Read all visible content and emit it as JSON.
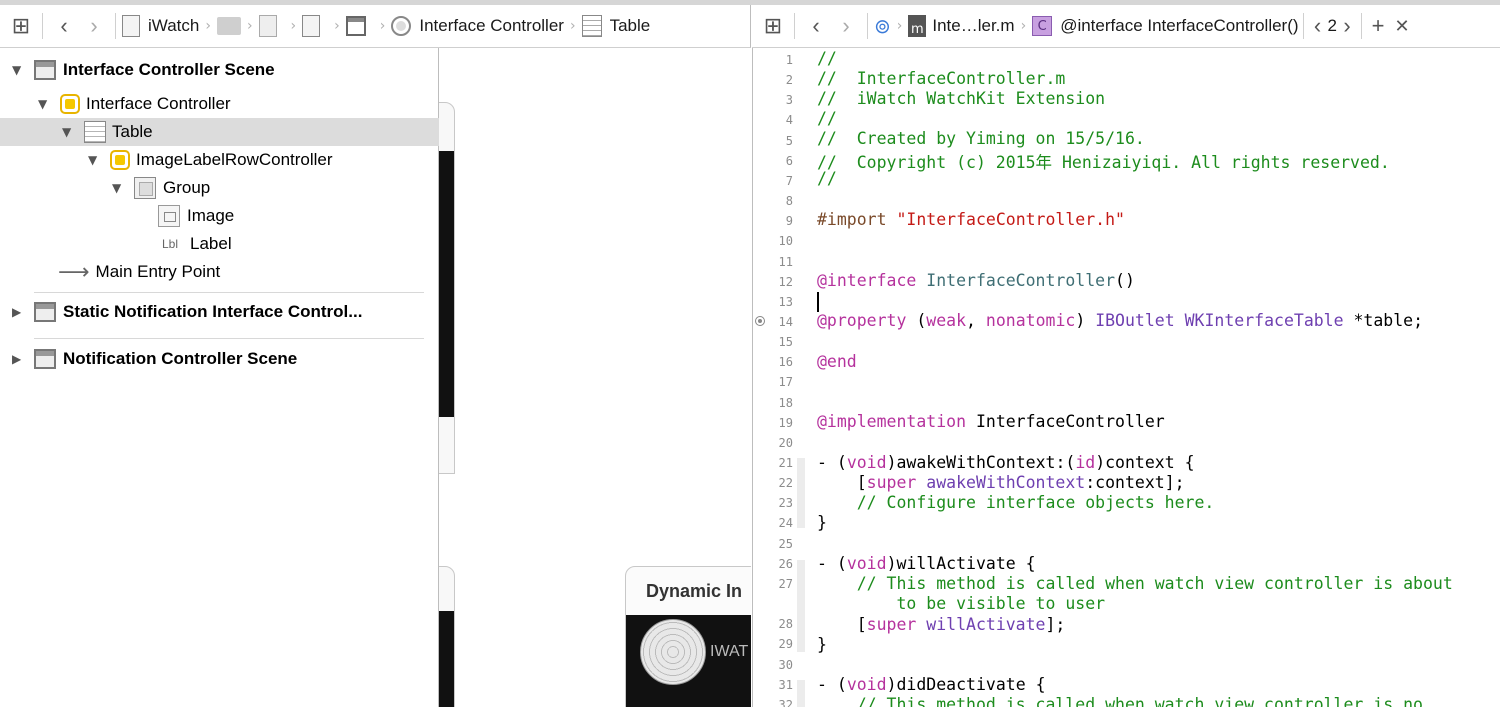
{
  "left_jumpbar": {
    "project": "iWatch",
    "crumb_controller": "Interface Controller",
    "crumb_table": "Table"
  },
  "right_jumpbar": {
    "file": "Inte…ler.m",
    "symbol": "@interface InterfaceController()",
    "counter": "2"
  },
  "outline": {
    "scene1": "Interface Controller Scene",
    "controller": "Interface Controller",
    "table": "Table",
    "row_controller": "ImageLabelRowController",
    "group": "Group",
    "image": "Image",
    "label_icon": "Lbl",
    "label": "Label",
    "entry": "Main Entry Point",
    "scene2": "Static Notification Interface Control...",
    "scene3": "Notification Controller Scene"
  },
  "canvas": {
    "dynamic_title": "Dynamic In",
    "dynamic_app": "IWAT"
  },
  "editor": {
    "line_numbers": [
      "1",
      "2",
      "3",
      "4",
      "5",
      "6",
      "7",
      "8",
      "9",
      "10",
      "11",
      "12",
      "13",
      "14",
      "15",
      "16",
      "17",
      "18",
      "19",
      "20",
      "21",
      "22",
      "23",
      "24",
      "25",
      "26",
      "27",
      "",
      "28",
      "29",
      "30",
      "31",
      "32"
    ],
    "l1": "//",
    "l2": "//  InterfaceController.m",
    "l3": "//  iWatch WatchKit Extension",
    "l4": "//",
    "l5": "//  Created by Yiming on 15/5/16.",
    "l6": "//  Copyright (c) 2015年 Henizaiyiqi. All rights reserved.",
    "l7": "//",
    "l9_kw": "#import",
    "l9_str": "\"InterfaceController.h\"",
    "l12_kw": "@interface",
    "l12_name": "InterfaceController",
    "l12_rest": "()",
    "l14_kw": "@property",
    "l14_open": " (",
    "l14_weak": "weak",
    "l14_comma": ", ",
    "l14_nonatomic": "nonatomic",
    "l14_close": ") ",
    "l14_ib": "IBOutlet",
    "l14_sp": " ",
    "l14_type": "WKInterfaceTable",
    "l14_var": " *table;",
    "l16": "@end",
    "l19_kw": "@implementation",
    "l19_name": " InterfaceController",
    "l21_a": "- (",
    "l21_void": "void",
    "l21_b": ")awakeWithContext:(",
    "l21_id": "id",
    "l21_c": ")context {",
    "l22_a": "    [",
    "l22_super": "super",
    "l22_sp": " ",
    "l22_method": "awakeWithContext",
    "l22_b": ":context];",
    "l23": "    // Configure interface objects here.",
    "l24": "}",
    "l26_a": "- (",
    "l26_void": "void",
    "l26_b": ")willActivate {",
    "l27a": "    // This method is called when watch view controller is about",
    "l27b": "        to be visible to user",
    "l28_a": "    [",
    "l28_super": "super",
    "l28_sp": " ",
    "l28_method": "willActivate",
    "l28_b": "];",
    "l29": "}",
    "l31_a": "- (",
    "l31_void": "void",
    "l31_b": ")didDeactivate {",
    "l32": "    // This method is called when watch view controller is no"
  }
}
